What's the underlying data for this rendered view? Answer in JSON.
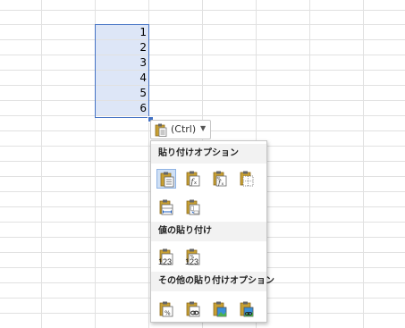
{
  "cells": [
    "1",
    "2",
    "3",
    "4",
    "5",
    "6"
  ],
  "ctrl_button": {
    "label": "(Ctrl)",
    "icon": "clipboard-icon",
    "caret_icon": "caret-down-icon"
  },
  "paste_menu": {
    "section_paste": "貼り付けオプション",
    "section_values": "値の貼り付け",
    "section_other": "その他の貼り付けオプション",
    "paste_options": [
      {
        "icon": "paste-icon",
        "selected": true
      },
      {
        "icon": "paste-formulas-icon"
      },
      {
        "icon": "paste-formulas-number-format-icon"
      },
      {
        "icon": "paste-no-borders-icon"
      },
      {
        "icon": "paste-keep-column-widths-icon"
      },
      {
        "icon": "paste-transpose-icon"
      }
    ],
    "value_options": [
      {
        "icon": "paste-values-icon",
        "caption": "123"
      },
      {
        "icon": "paste-values-number-format-icon",
        "caption": "123"
      }
    ],
    "other_options": [
      {
        "icon": "paste-formatting-icon"
      },
      {
        "icon": "paste-link-icon"
      },
      {
        "icon": "paste-picture-icon"
      },
      {
        "icon": "paste-linked-picture-icon"
      }
    ]
  },
  "colors": {
    "selection": "#4472c4",
    "selection_fill": "#dde6f7",
    "grid": "#e1e1e1",
    "clipboard": "#c8a032"
  }
}
